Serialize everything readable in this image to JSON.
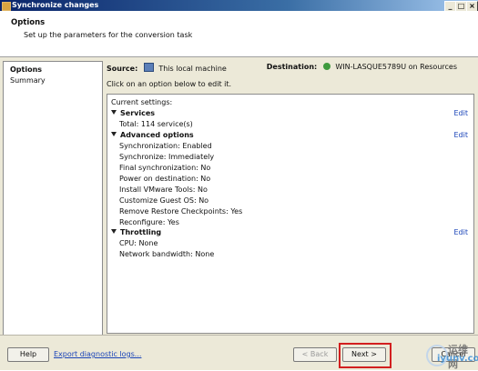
{
  "window": {
    "title": "Synchronize changes",
    "minimize": "_",
    "maximize": "□",
    "close": "×"
  },
  "header": {
    "title": "Options",
    "subtitle": "Set up the parameters for the conversion task"
  },
  "nav": {
    "items": [
      {
        "label": "Options",
        "active": true
      },
      {
        "label": "Summary",
        "active": false
      }
    ]
  },
  "source": {
    "label": "Source:",
    "value": "This local machine",
    "icon": "monitor-icon"
  },
  "destination": {
    "label": "Destination:",
    "value": "WIN-LASQUE5789U on Resources",
    "icon": "network-host-icon"
  },
  "hint": "Click on an option below to edit it.",
  "settings": {
    "heading": "Current settings:",
    "edit_label": "Edit",
    "services": {
      "title": "Services",
      "total": "Total: 114 service(s)"
    },
    "advanced": {
      "title": "Advanced options",
      "items": [
        "Synchronization: Enabled",
        "Synchronize: Immediately",
        "Final synchronization: No",
        "Power on destination: No",
        "Install VMware Tools: No",
        "Customize Guest OS: No",
        "Remove Restore Checkpoints: Yes",
        "Reconfigure: Yes"
      ]
    },
    "throttling": {
      "title": "Throttling",
      "items": [
        "CPU: None",
        "Network bandwidth: None"
      ]
    }
  },
  "footer": {
    "help": "Help",
    "export_logs": "Export diagnostic logs...",
    "back": "< Back",
    "next": "Next >",
    "cancel": "Cancel"
  },
  "watermark": {
    "cn": "运维网",
    "en": "iyunv.com"
  }
}
